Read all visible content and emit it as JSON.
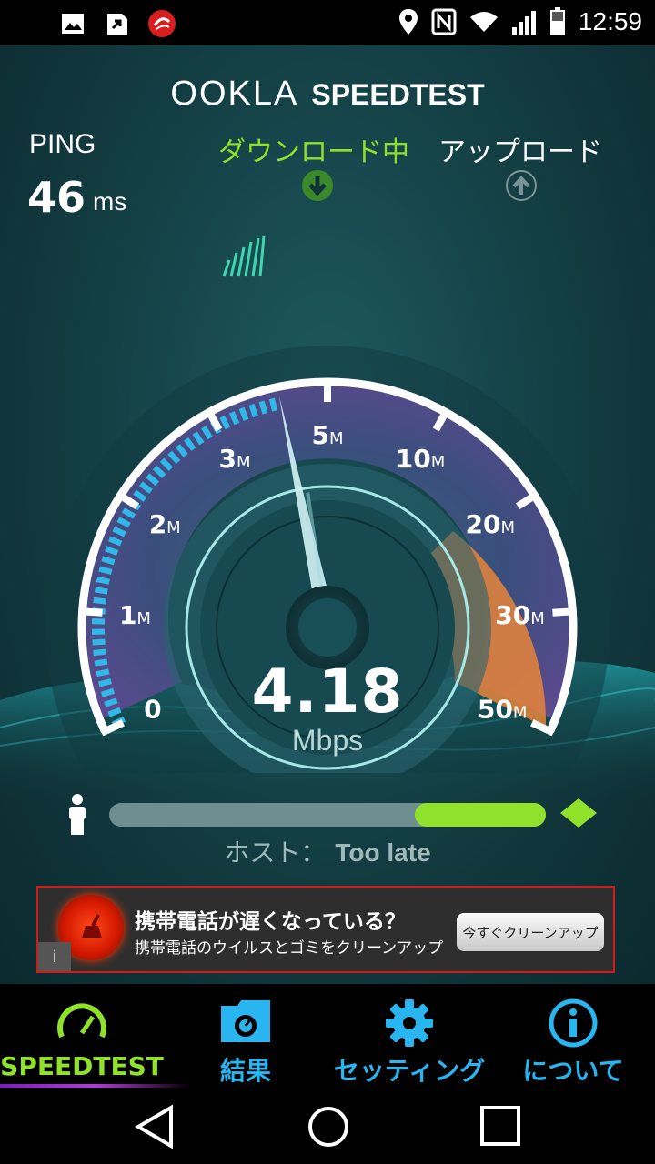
{
  "status_bar": {
    "time": "12:59",
    "left_icons": [
      "image-icon",
      "download-app-icon",
      "trendmicro-icon"
    ],
    "right_icons": [
      "location-icon",
      "nfc-icon",
      "wifi-icon",
      "signal-icon",
      "battery-icon"
    ]
  },
  "header": {
    "brand": "OOKLA",
    "product": "SPEEDTEST"
  },
  "ping": {
    "label": "PING",
    "value": "46",
    "unit": "ms"
  },
  "phases": {
    "download_label": "ダウンロード中",
    "upload_label": "アップロード",
    "download_color": "#8fe12a",
    "upload_color": "#ffffff"
  },
  "gauge": {
    "ticks": [
      {
        "num": "0",
        "unit": ""
      },
      {
        "num": "1",
        "unit": "M"
      },
      {
        "num": "2",
        "unit": "M"
      },
      {
        "num": "3",
        "unit": "M"
      },
      {
        "num": "5",
        "unit": "M"
      },
      {
        "num": "10",
        "unit": "M"
      },
      {
        "num": "20",
        "unit": "M"
      },
      {
        "num": "30",
        "unit": "M"
      },
      {
        "num": "50",
        "unit": "M"
      }
    ],
    "current_mbps": 4.18,
    "accent": "#2fb8e8",
    "warning": "#e8843a"
  },
  "speed": {
    "value": "4.18",
    "unit": "Mbps"
  },
  "progress": {
    "fraction": 0.3
  },
  "host": {
    "label": "ホスト：",
    "value": "Too late"
  },
  "ad": {
    "title": "携帯電話が遅くなっている？",
    "subtitle": "携帯電話のウイルスとゴミをクリーンアップ",
    "button": "今すぐクリーンアップ",
    "info": "i"
  },
  "tabs": [
    {
      "label": "SPEEDTEST",
      "color": "#8fe12a",
      "icon": "speedometer-icon"
    },
    {
      "label": "結果",
      "color": "#29b6f0",
      "icon": "results-folder-icon"
    },
    {
      "label": "セッティング",
      "color": "#29b6f0",
      "icon": "gear-icon"
    },
    {
      "label": "について",
      "color": "#29b6f0",
      "icon": "info-icon"
    }
  ],
  "nav": [
    "back-icon",
    "home-icon",
    "recents-icon"
  ]
}
